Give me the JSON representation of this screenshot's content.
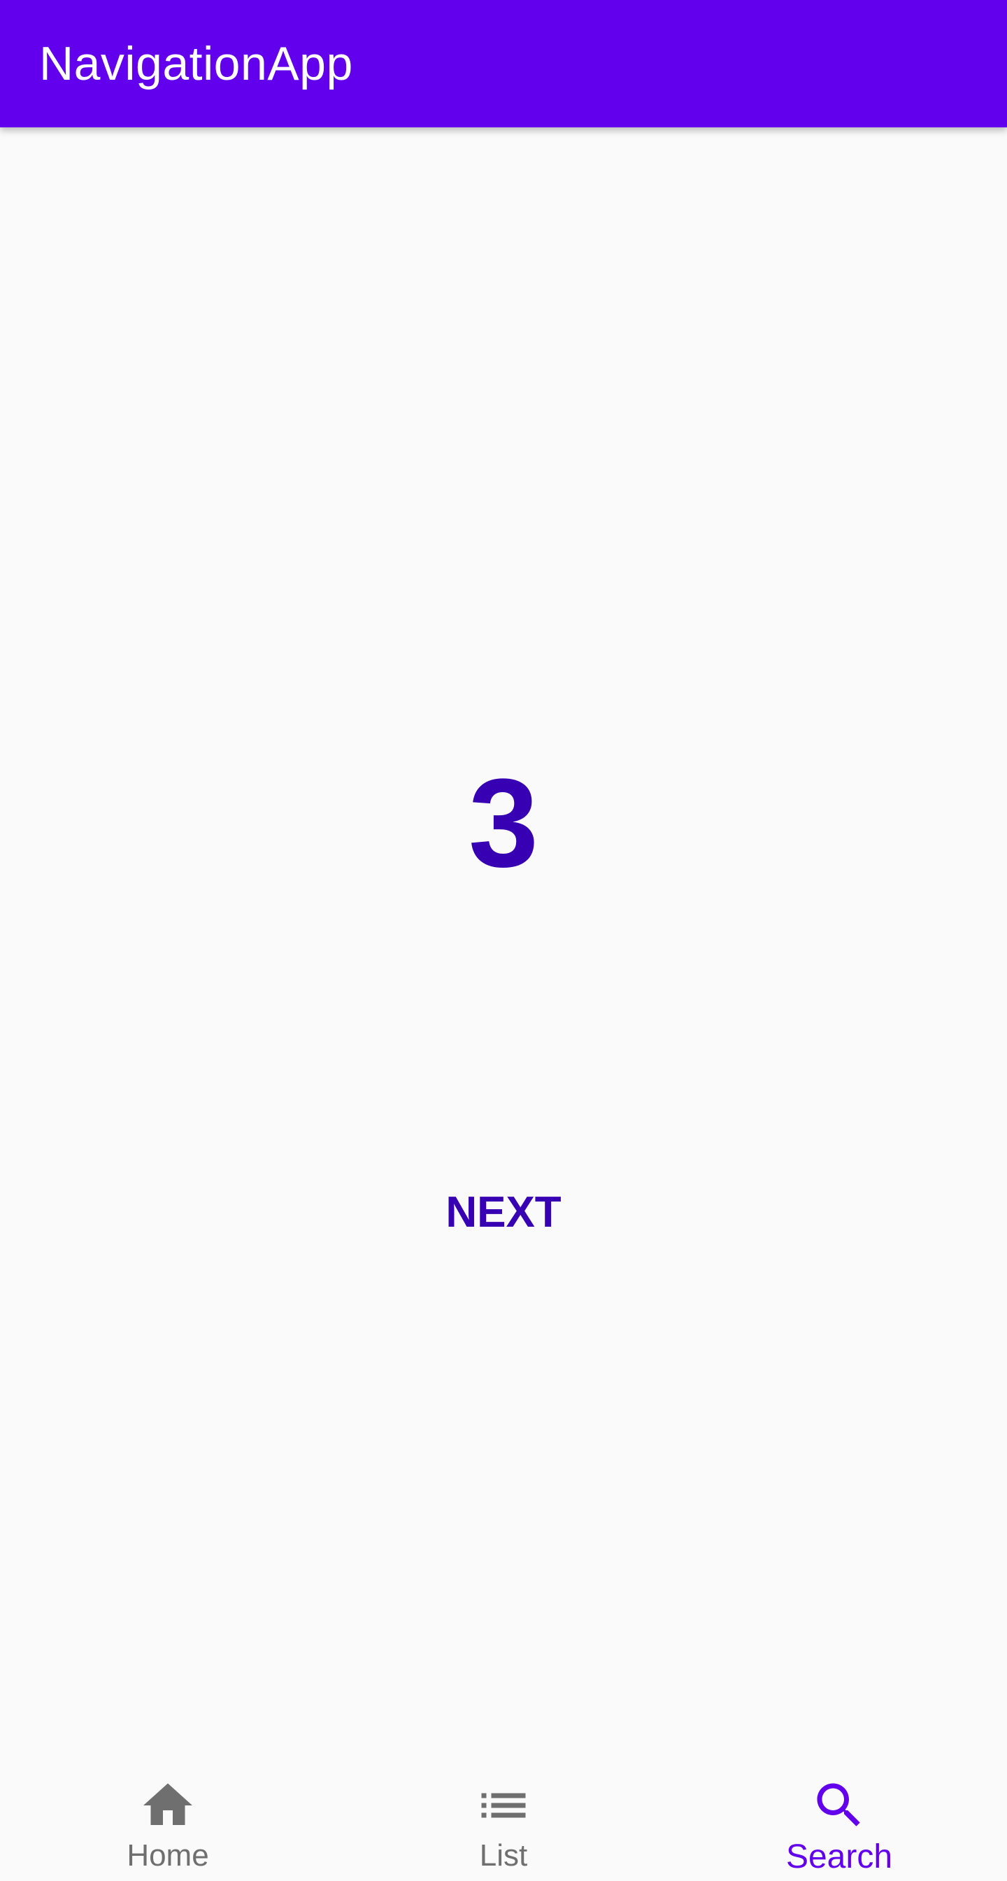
{
  "app_bar": {
    "title": "NavigationApp"
  },
  "main": {
    "counter": "3",
    "next_label": "NEXT"
  },
  "bottom_nav": {
    "items": [
      {
        "label": "Home",
        "icon": "home-icon",
        "active": false
      },
      {
        "label": "List",
        "icon": "list-icon",
        "active": false
      },
      {
        "label": "Search",
        "icon": "search-icon",
        "active": true
      }
    ]
  },
  "colors": {
    "primary": "#6200ee",
    "primary_dark": "#3700b3",
    "inactive": "#6f6f6f",
    "background": "#fafafa"
  }
}
